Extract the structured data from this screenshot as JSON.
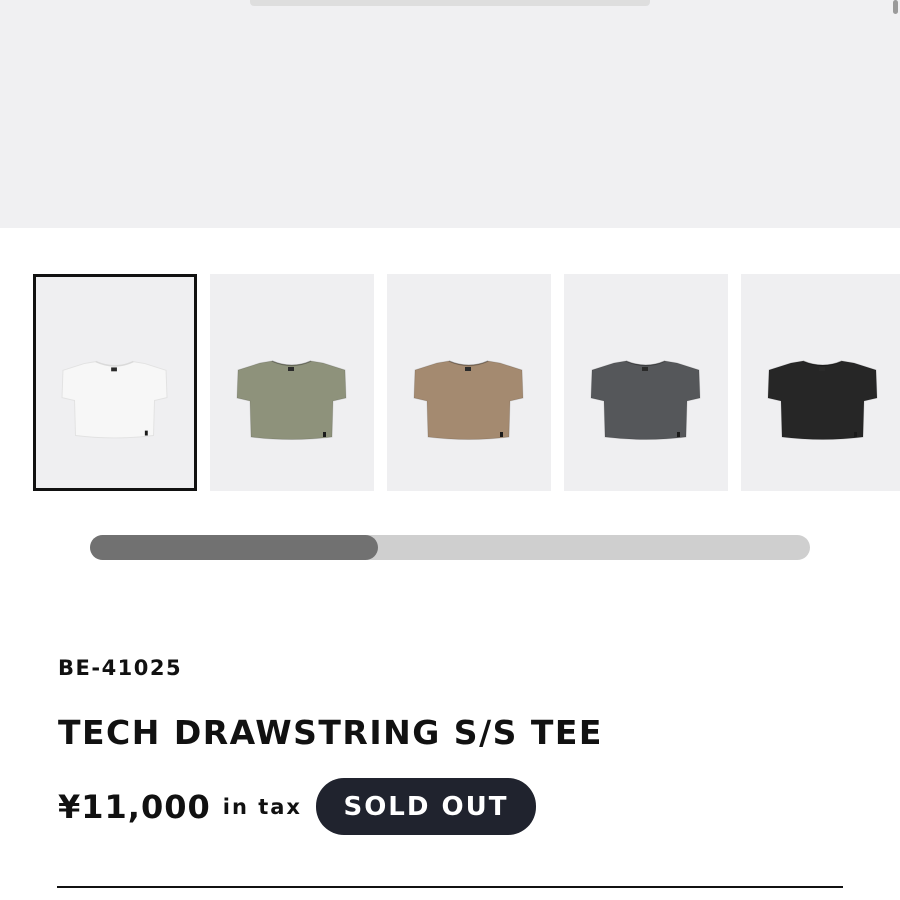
{
  "product": {
    "sku": "BE-41025",
    "title": "TECH DRAWSTRING S/S TEE",
    "price": "¥11,000",
    "tax_label": "in tax",
    "status_label": "SOLD OUT"
  },
  "gallery": {
    "scroll_progress": 0.4,
    "selected_index": 0,
    "thumbnails": [
      {
        "color": "#f7f7f7"
      },
      {
        "color": "#8e927b"
      },
      {
        "color": "#a48a70"
      },
      {
        "color": "#55575a"
      },
      {
        "color": "#262626"
      }
    ]
  },
  "colors": {
    "status_badge": "#20232e",
    "scrollbar_track": "#cfcfcf",
    "scrollbar_thumb": "#717171"
  }
}
